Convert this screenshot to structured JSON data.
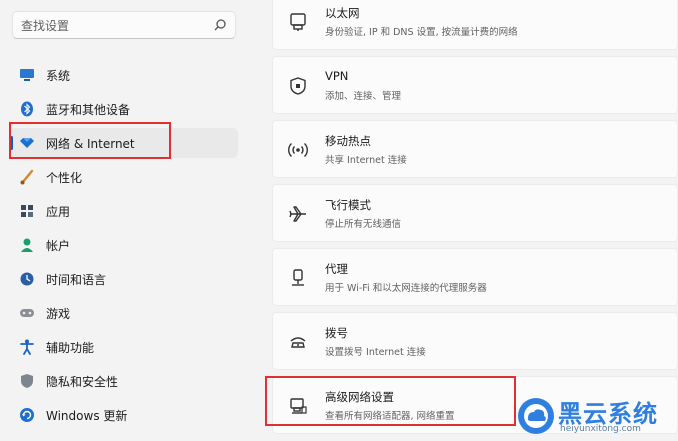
{
  "search": {
    "placeholder": "查找设置"
  },
  "sidebar": {
    "items": [
      {
        "label": "系统",
        "icon": "monitor-icon"
      },
      {
        "label": "蓝牙和其他设备",
        "icon": "bluetooth-icon"
      },
      {
        "label": "网络 & Internet",
        "icon": "wifi-diamond-icon",
        "active": true
      },
      {
        "label": "个性化",
        "icon": "brush-icon"
      },
      {
        "label": "应用",
        "icon": "apps-icon"
      },
      {
        "label": "帐户",
        "icon": "person-icon"
      },
      {
        "label": "时间和语言",
        "icon": "clock-globe-icon"
      },
      {
        "label": "游戏",
        "icon": "gamepad-icon"
      },
      {
        "label": "辅助功能",
        "icon": "accessibility-icon"
      },
      {
        "label": "隐私和安全性",
        "icon": "shield-icon"
      },
      {
        "label": "Windows 更新",
        "icon": "update-icon"
      }
    ]
  },
  "cards": [
    {
      "title": "以太网",
      "subtitle": "身份验证, IP 和 DNS 设置, 按流量计费的网络",
      "icon": "ethernet-icon"
    },
    {
      "title": "VPN",
      "subtitle": "添加、连接、管理",
      "icon": "vpn-shield-icon"
    },
    {
      "title": "移动热点",
      "subtitle": "共享 Internet 连接",
      "icon": "hotspot-icon"
    },
    {
      "title": "飞行模式",
      "subtitle": "停止所有无线通信",
      "icon": "airplane-icon"
    },
    {
      "title": "代理",
      "subtitle": "用于 Wi-Fi 和以太网连接的代理服务器",
      "icon": "proxy-icon"
    },
    {
      "title": "拨号",
      "subtitle": "设置拨号 Internet 连接",
      "icon": "dialup-icon"
    },
    {
      "title": "高级网络设置",
      "subtitle": "查看所有网络适配器, 网络重置",
      "icon": "advanced-network-icon"
    }
  ],
  "watermark": {
    "name": "黑云系统",
    "url": "heiyunxitong.com"
  },
  "colors": {
    "accent": "#0067c0",
    "highlight": "#e03131",
    "watermark": "#2f7fe0"
  }
}
